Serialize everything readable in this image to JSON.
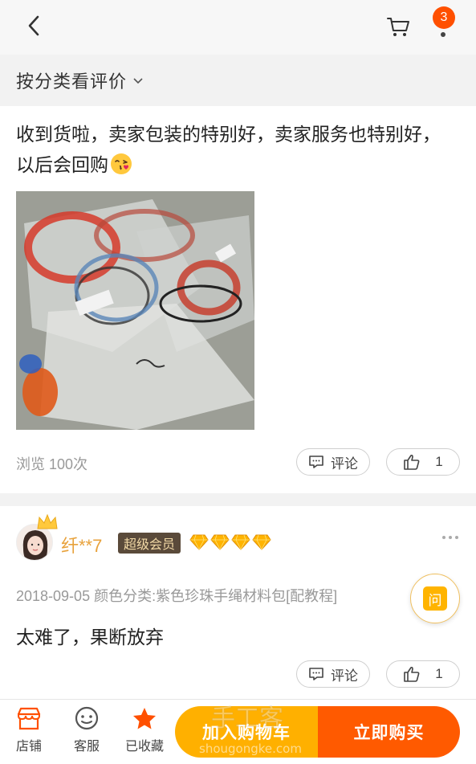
{
  "header": {
    "back_icon": "chevron-left-icon",
    "cart_icon": "cart-icon",
    "more_badge": "3",
    "more_icon": "more-dot-icon"
  },
  "filter": {
    "label": "按分类看评价",
    "icon": "chevron-down-icon"
  },
  "review1": {
    "text": "收到货啦，卖家包装的特别好，卖家服务也特别好，以后会回购",
    "emoji": "kiss-emoji-icon",
    "views": "浏览 100次",
    "comment_label": "评论",
    "like_count": "1"
  },
  "review2": {
    "username": "纤**7",
    "vip_label": "超级会员",
    "diamond_count": 4,
    "meta": "2018-09-05 颜色分类:紫色珍珠手绳材料包[配教程]",
    "text": "太难了，果断放弃",
    "comment_label": "评论",
    "like_count": "1"
  },
  "ask_button": {
    "label": "问"
  },
  "bottom_bar": {
    "shop_label": "店铺",
    "service_label": "客服",
    "favorite_label": "已收藏",
    "add_to_cart_label": "加入购物车",
    "buy_now_label": "立即购买"
  },
  "watermark": {
    "line1": "手工客",
    "line2": "shougongke.com"
  },
  "colors": {
    "accent_orange": "#ff5000",
    "cart_yellow": "#ffb000",
    "buy_orange": "#ff5a00",
    "username_gold": "#e8a23c"
  }
}
